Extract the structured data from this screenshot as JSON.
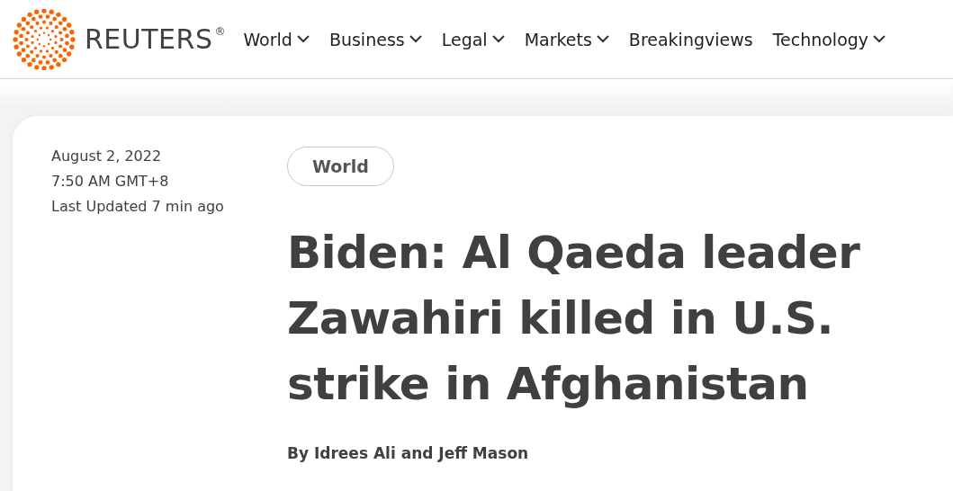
{
  "header": {
    "logo_text": "REUTERS",
    "registered_mark": "®",
    "nav": [
      {
        "label": "World",
        "has_menu": true
      },
      {
        "label": "Business",
        "has_menu": true
      },
      {
        "label": "Legal",
        "has_menu": true
      },
      {
        "label": "Markets",
        "has_menu": true
      },
      {
        "label": "Breakingviews",
        "has_menu": false
      },
      {
        "label": "Technology",
        "has_menu": true
      }
    ]
  },
  "article": {
    "date": "August 2, 2022",
    "time": "7:50 AM GMT+8",
    "updated": "Last Updated 7 min ago",
    "section_tag": "World",
    "headline": "Biden: Al Qaeda leader Zawahiri killed in U.S. strike in Afghanistan",
    "byline": "By Idrees Ali and Jeff Mason"
  }
}
